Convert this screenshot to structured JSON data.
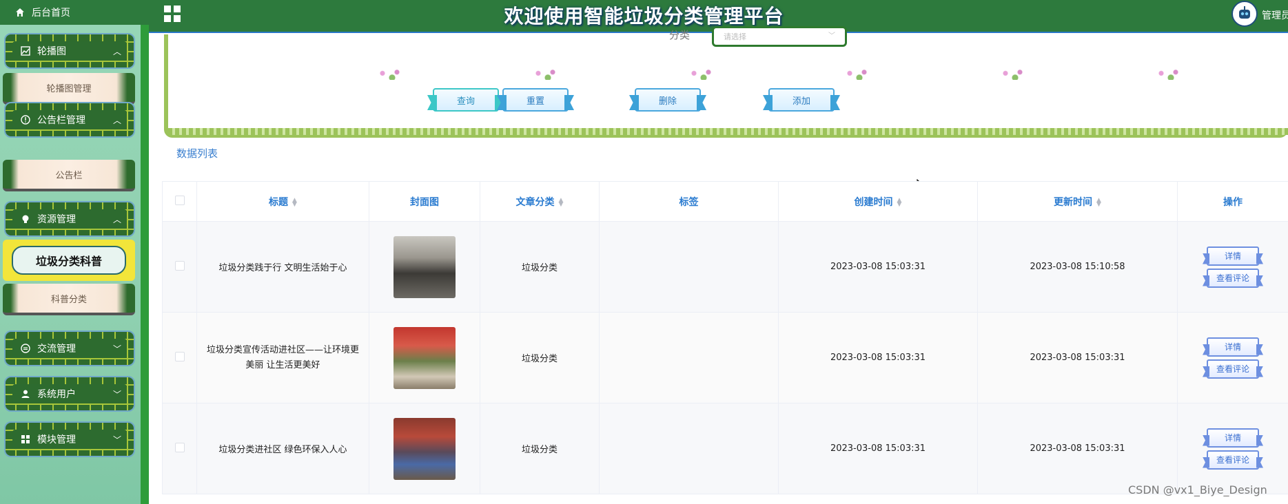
{
  "header": {
    "title": "欢迎使用智能垃圾分类管理平台",
    "home_label": "后台首页",
    "admin_label": "管理员"
  },
  "sidebar": {
    "items": [
      {
        "type": "parent",
        "label": "轮播图",
        "icon": "image-chart-icon",
        "expanded": true
      },
      {
        "type": "child",
        "label": "轮播图管理"
      },
      {
        "type": "parent",
        "label": "公告栏管理",
        "icon": "info-circle-icon",
        "expanded": true
      },
      {
        "type": "child",
        "label": "公告栏"
      },
      {
        "type": "parent",
        "label": "资源管理",
        "icon": "lightbulb-icon",
        "expanded": true
      },
      {
        "type": "child",
        "label": "垃圾分类科普",
        "active": true
      },
      {
        "type": "child",
        "label": "科普分类"
      },
      {
        "type": "parent",
        "label": "交流管理",
        "icon": "chat-icon",
        "expanded": false
      },
      {
        "type": "parent",
        "label": "系统用户",
        "icon": "user-icon",
        "expanded": false
      },
      {
        "type": "parent",
        "label": "模块管理",
        "icon": "grid-icon",
        "expanded": false
      }
    ]
  },
  "filter": {
    "category_label": "分类",
    "category_placeholder": "请选择",
    "buttons": {
      "search": "查询",
      "reset": "重置",
      "delete": "删除",
      "add": "添加"
    }
  },
  "list_title": "数据列表",
  "table": {
    "columns": [
      "标题",
      "封面图",
      "文章分类",
      "标签",
      "创建时间",
      "更新时间",
      "操作"
    ],
    "sortable": [
      true,
      false,
      true,
      false,
      true,
      true,
      false
    ],
    "rows": [
      {
        "title": "垃圾分类践于行 文明生活始于心",
        "category": "垃圾分类",
        "tag": "",
        "created": "2023-03-08 15:03:31",
        "updated": "2023-03-08 15:10:58"
      },
      {
        "title": "垃圾分类宣传活动进社区——让环境更美丽 让生活更美好",
        "category": "垃圾分类",
        "tag": "",
        "created": "2023-03-08 15:03:31",
        "updated": "2023-03-08 15:03:31"
      },
      {
        "title": "垃圾分类进社区 绿色环保入人心",
        "category": "垃圾分类",
        "tag": "",
        "created": "2023-03-08 15:03:31",
        "updated": "2023-03-08 15:03:31"
      }
    ],
    "row_actions": {
      "detail": "详情",
      "comments": "查看评论"
    }
  },
  "watermark": "CSDN @vx1_Biye_Design",
  "colors": {
    "header_green": "#2d7a3d",
    "sidebar_bg": "#96d6b6",
    "accent_blue": "#2a7bd0",
    "active_yellow": "#f2e53a"
  }
}
